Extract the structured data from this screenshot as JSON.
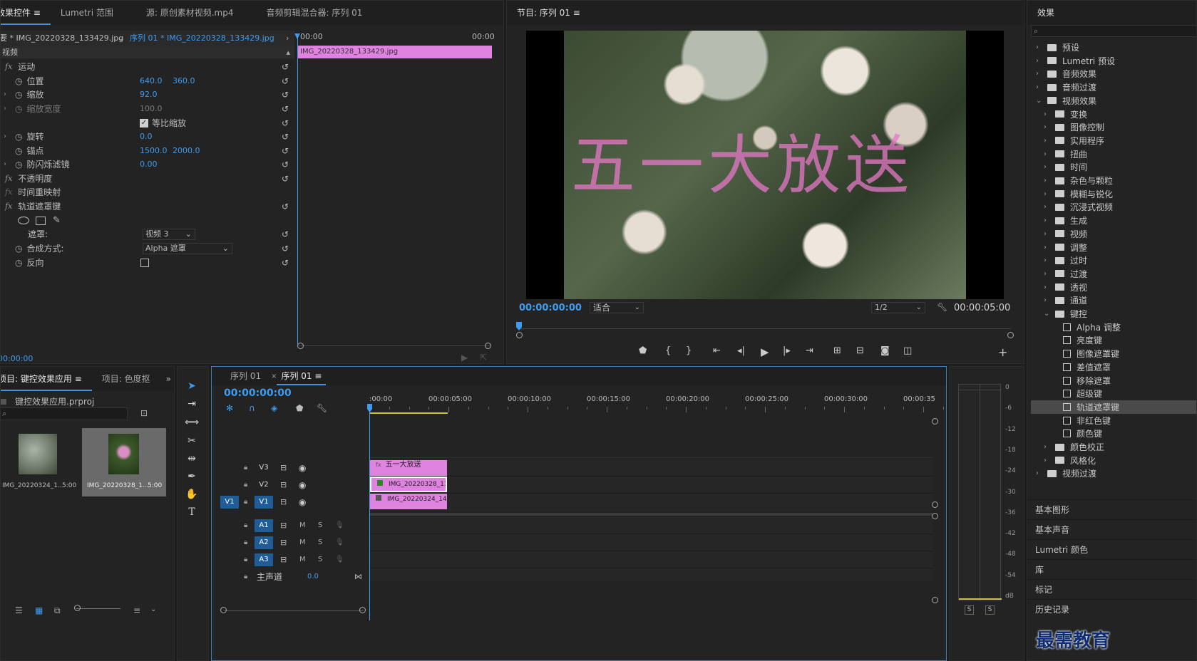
{
  "effect_controls": {
    "tabs": [
      "效果控件",
      "Lumetri 范围",
      "源: 原创素材视频.mp4",
      "音频剪辑混合器: 序列 01"
    ],
    "source": "要 * IMG_20220328_133429.jpg",
    "sequence": "序列 01 * IMG_20220328_133429.jpg",
    "time_start": "00:00",
    "time_end": "00:00",
    "clip_label": "IMG_20220328_133429.jpg",
    "video_header": "视频",
    "motion": "运动",
    "position_label": "位置",
    "position_x": "640.0",
    "position_y": "360.0",
    "scale_label": "缩放",
    "scale_value": "92.0",
    "scale_width_label": "缩放宽度",
    "scale_width_value": "100.0",
    "uniform_scale_label": "等比缩放",
    "rotation_label": "旋转",
    "rotation_value": "0.0",
    "anchor_label": "锚点",
    "anchor_x": "1500.0",
    "anchor_y": "2000.0",
    "flicker_label": "防闪烁滤镜",
    "flicker_value": "0.00",
    "opacity_label": "不透明度",
    "time_remap_label": "时间重映射",
    "track_matte_label": "轨道遮罩键",
    "matte_label": "遮罩:",
    "matte_value": "视频 3",
    "composite_label": "合成方式:",
    "composite_value": "Alpha 遮罩",
    "reverse_label": "反向",
    "timecode": "00:00:00"
  },
  "program": {
    "title": "节目: 序列 01",
    "overlay_text": "五一大放送",
    "timecode": "00:00:00:00",
    "fit": "适合",
    "quality": "1/2",
    "duration": "00:00:05:00"
  },
  "effects": {
    "title": "效果",
    "items": [
      {
        "label": "预设",
        "level": 0,
        "type": "folder",
        "open": false
      },
      {
        "label": "Lumetri 预设",
        "level": 0,
        "type": "folder",
        "open": false
      },
      {
        "label": "音频效果",
        "level": 0,
        "type": "folder",
        "open": false
      },
      {
        "label": "音频过渡",
        "level": 0,
        "type": "folder",
        "open": false
      },
      {
        "label": "视频效果",
        "level": 0,
        "type": "folder",
        "open": true
      },
      {
        "label": "变换",
        "level": 1,
        "type": "folder",
        "open": false
      },
      {
        "label": "图像控制",
        "level": 1,
        "type": "folder",
        "open": false
      },
      {
        "label": "实用程序",
        "level": 1,
        "type": "folder",
        "open": false
      },
      {
        "label": "扭曲",
        "level": 1,
        "type": "folder",
        "open": false
      },
      {
        "label": "时间",
        "level": 1,
        "type": "folder",
        "open": false
      },
      {
        "label": "杂色与颗粒",
        "level": 1,
        "type": "folder",
        "open": false
      },
      {
        "label": "模糊与锐化",
        "level": 1,
        "type": "folder",
        "open": false
      },
      {
        "label": "沉浸式视频",
        "level": 1,
        "type": "folder",
        "open": false
      },
      {
        "label": "生成",
        "level": 1,
        "type": "folder",
        "open": false
      },
      {
        "label": "视频",
        "level": 1,
        "type": "folder",
        "open": false
      },
      {
        "label": "调整",
        "level": 1,
        "type": "folder",
        "open": false
      },
      {
        "label": "过时",
        "level": 1,
        "type": "folder",
        "open": false
      },
      {
        "label": "过渡",
        "level": 1,
        "type": "folder",
        "open": false
      },
      {
        "label": "透视",
        "level": 1,
        "type": "folder",
        "open": false
      },
      {
        "label": "通道",
        "level": 1,
        "type": "folder",
        "open": false
      },
      {
        "label": "键控",
        "level": 1,
        "type": "folder",
        "open": true
      },
      {
        "label": "Alpha 调整",
        "level": 2,
        "type": "effect"
      },
      {
        "label": "亮度键",
        "level": 2,
        "type": "effect"
      },
      {
        "label": "图像遮罩键",
        "level": 2,
        "type": "effect"
      },
      {
        "label": "差值遮罩",
        "level": 2,
        "type": "effect"
      },
      {
        "label": "移除遮罩",
        "level": 2,
        "type": "effect"
      },
      {
        "label": "超级键",
        "level": 2,
        "type": "effect"
      },
      {
        "label": "轨道遮罩键",
        "level": 2,
        "type": "effect",
        "selected": true
      },
      {
        "label": "非红色键",
        "level": 2,
        "type": "effect"
      },
      {
        "label": "颜色键",
        "level": 2,
        "type": "effect"
      },
      {
        "label": "颜色校正",
        "level": 1,
        "type": "folder",
        "open": false
      },
      {
        "label": "风格化",
        "level": 1,
        "type": "folder",
        "open": false
      },
      {
        "label": "视频过渡",
        "level": 0,
        "type": "folder",
        "open": false
      }
    ],
    "panels": [
      "基本图形",
      "基本声音",
      "Lumetri 颜色",
      "库",
      "标记",
      "历史记录"
    ]
  },
  "project": {
    "tabs": [
      "项目: 键控效果应用",
      "项目: 色度抠"
    ],
    "file": "键控效果应用.prproj",
    "items": [
      {
        "name": "IMG_20220324_1...",
        "duration": "5:00"
      },
      {
        "name": "IMG_20220328_1...",
        "duration": "5:00"
      }
    ]
  },
  "timeline": {
    "tabs": [
      "序列 01",
      "序列 01"
    ],
    "timecode": "00:00:00:00",
    "ruler": [
      ":00:00",
      "00:00:05:00",
      "00:00:10:00",
      "00:00:15:00",
      "00:00:20:00",
      "00:00:25:00",
      "00:00:30:00",
      "00:00:35"
    ],
    "video_tracks": [
      "V3",
      "V2",
      "V1"
    ],
    "audio_tracks": [
      "A1",
      "A2",
      "A3"
    ],
    "source_patch": "V1",
    "master_label": "主声道",
    "master_value": "0.0",
    "clip_v3": "五一大放送",
    "clip_v2": "IMG_20220328_133",
    "clip_v1": "IMG_20220324_145",
    "m": "M",
    "s": "S"
  },
  "meter": {
    "scale": [
      "0",
      "-6",
      "-12",
      "-18",
      "-24",
      "-30",
      "-36",
      "-42",
      "-48",
      "-54",
      "dB"
    ],
    "solo": [
      "S",
      "S"
    ]
  },
  "watermark": "最需教育",
  "colors": {
    "accent": "#3d9cf0",
    "clip_pink": "#e083e0",
    "panel": "#232323"
  }
}
